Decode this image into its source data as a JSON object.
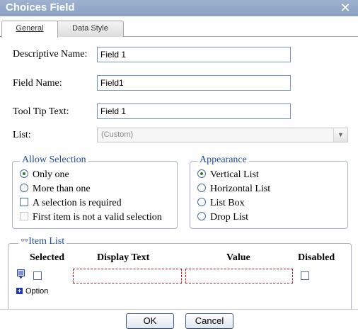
{
  "window": {
    "title": "Choices Field",
    "close_glyph": "✕"
  },
  "tabs": [
    {
      "label": "General",
      "active": true
    },
    {
      "label": "Data Style",
      "active": false
    }
  ],
  "fields": {
    "descriptive_name": {
      "label": "Descriptive Name:",
      "value": "Field 1"
    },
    "field_name": {
      "label": "Field Name:",
      "value": "Field1"
    },
    "tool_tip": {
      "label": "Tool Tip Text:",
      "value": "Field 1"
    },
    "list": {
      "label": "List:",
      "value": "(Custom)"
    }
  },
  "allow_selection": {
    "legend": "Allow Selection",
    "options": [
      {
        "label": "Only one",
        "selected": true
      },
      {
        "label": "More than one",
        "selected": false
      }
    ],
    "checks": [
      {
        "label": "A selection is required",
        "checked": false
      },
      {
        "label": "First item is not a valid selection",
        "checked": false,
        "disabled": true
      }
    ]
  },
  "appearance": {
    "legend": "Appearance",
    "options": [
      {
        "label": "Vertical List",
        "selected": true
      },
      {
        "label": "Horizontal List",
        "selected": false
      },
      {
        "label": "List Box",
        "selected": false
      },
      {
        "label": "Drop List",
        "selected": false
      }
    ]
  },
  "item_list": {
    "legend": "Item List",
    "columns": [
      "Selected",
      "Display Text",
      "Value",
      "Disabled"
    ],
    "rows": [
      {
        "selected": false,
        "display_text": "",
        "value": "",
        "disabled": false
      }
    ],
    "add_label": "Option"
  },
  "buttons": {
    "ok": "OK",
    "cancel": "Cancel"
  },
  "colors": {
    "title_bar": "#8ba0c4",
    "legend": "#1c4a9c",
    "error_border": "#c81414"
  }
}
